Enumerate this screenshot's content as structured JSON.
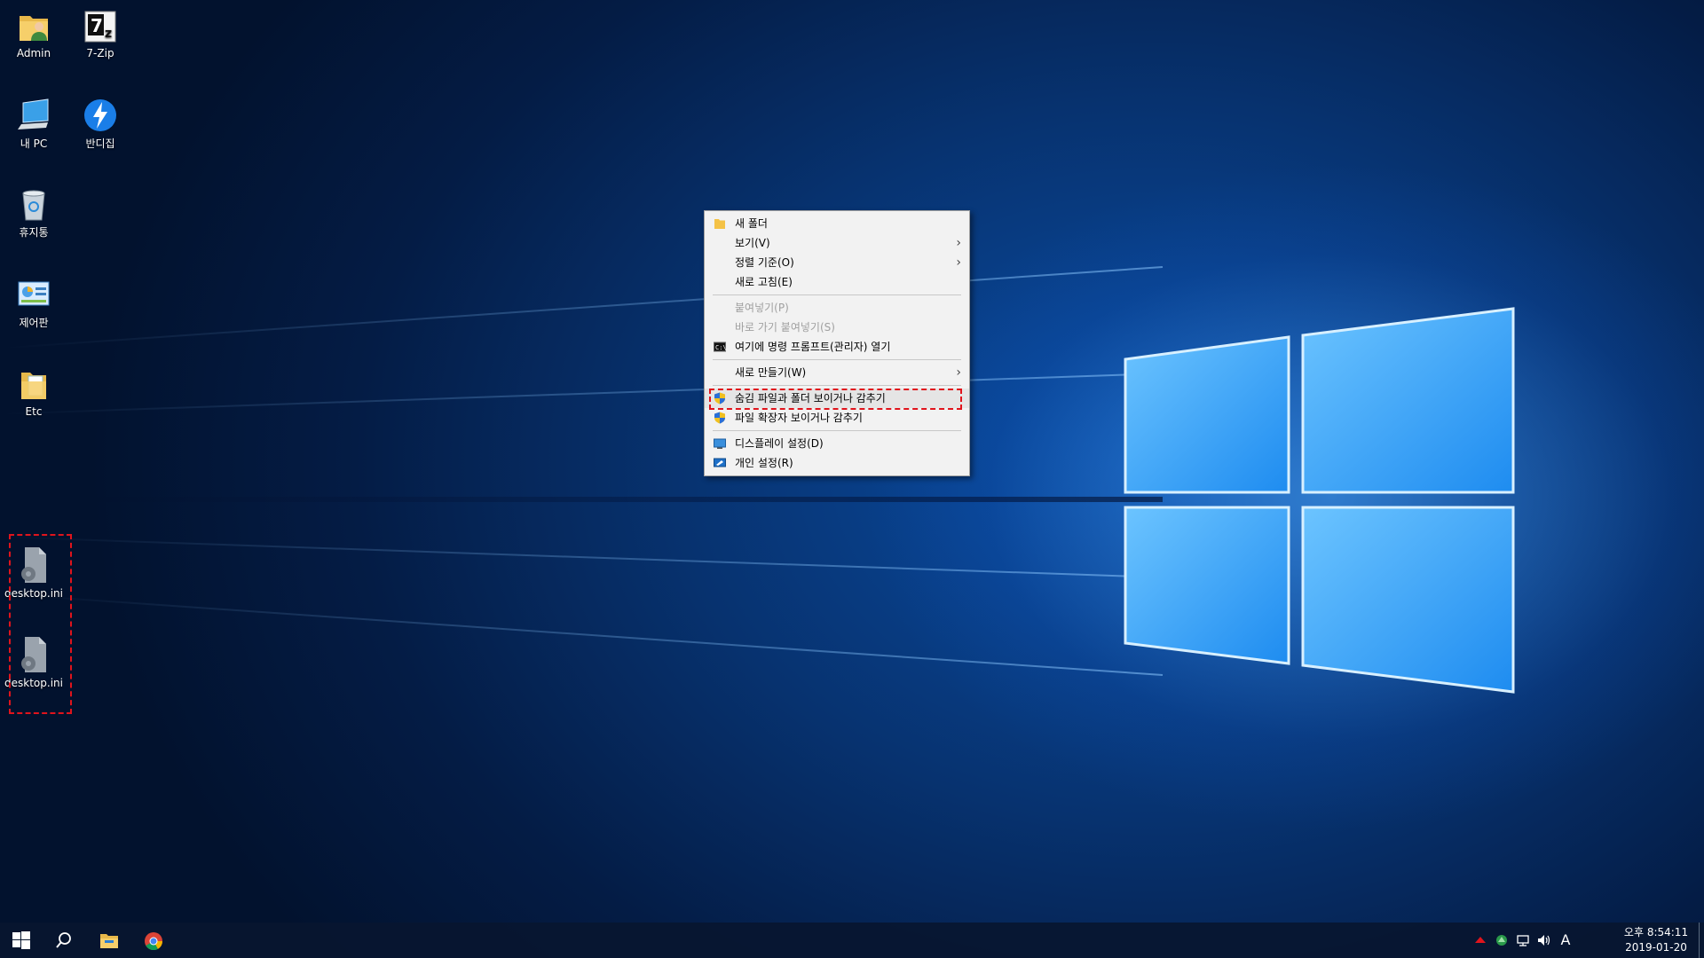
{
  "desktop": {
    "icons": [
      {
        "label": "Admin",
        "icon": "user-folder-icon"
      },
      {
        "label": "7-Zip",
        "icon": "seven-zip-icon"
      },
      {
        "label": "내 PC",
        "icon": "computer-icon"
      },
      {
        "label": "반디집",
        "icon": "bandizip-icon"
      },
      {
        "label": "휴지통",
        "icon": "recycle-bin-icon"
      },
      {
        "label": "제어판",
        "icon": "control-panel-icon"
      },
      {
        "label": "Etc",
        "icon": "folder-icon"
      },
      {
        "label": "desktop.ini",
        "icon": "settings-file-icon"
      },
      {
        "label": "desktop.ini",
        "icon": "settings-file-icon"
      }
    ]
  },
  "context_menu": {
    "items": [
      {
        "label": "새 폴더",
        "icon": "folder-icon"
      },
      {
        "label": "보기(V)",
        "submenu": true
      },
      {
        "label": "정렬 기준(O)",
        "submenu": true
      },
      {
        "label": "새로 고침(E)"
      },
      {
        "label": "붙여넣기(P)",
        "disabled": true
      },
      {
        "label": "바로 가기 붙여넣기(S)",
        "disabled": true
      },
      {
        "label": "여기에 명령 프롬프트(관리자) 열기",
        "icon": "command-prompt-icon"
      },
      {
        "label": "새로 만들기(W)",
        "submenu": true
      },
      {
        "label": "숨김 파일과 폴더 보이거나 감추기",
        "icon": "shield-icon"
      },
      {
        "label": "파일 확장자 보이거나 감추기",
        "icon": "shield-icon"
      },
      {
        "label": "디스플레이 설정(D)",
        "icon": "display-icon"
      },
      {
        "label": "개인 설정(R)",
        "icon": "personalize-icon"
      }
    ],
    "arrow_glyph": "›"
  },
  "taskbar": {
    "clock": {
      "time": "오후 8:54:11",
      "date": "2019-01-20"
    },
    "ime": "A"
  },
  "colors": {
    "highlight": "#e0141c",
    "menu_bg": "#f2f2f2",
    "taskbar_bg": "#08162f"
  }
}
